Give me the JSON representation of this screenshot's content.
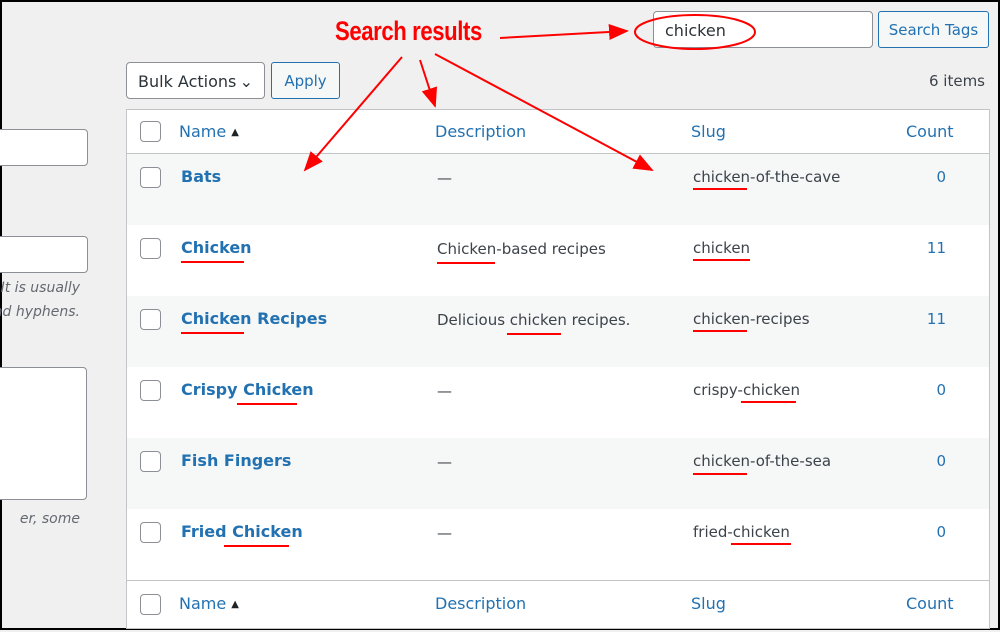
{
  "search": {
    "value": "chicken",
    "button": "Search Tags"
  },
  "bulk": {
    "select": "Bulk Actions",
    "apply": "Apply"
  },
  "items_count": "6 items",
  "left_form": {
    "hint1a": "It is usually",
    "hint1b": "nd hyphens.",
    "hint2": "er, some"
  },
  "columns": {
    "name": "Name",
    "description": "Description",
    "slug": "Slug",
    "count": "Count",
    "sort_icon": "triangle-up"
  },
  "rows": [
    {
      "name": "Bats",
      "description": "—",
      "slug": "chicken-of-the-cave",
      "count": "0"
    },
    {
      "name": "Chicken",
      "description": "Chicken-based recipes",
      "slug": "chicken",
      "count": "11"
    },
    {
      "name": "Chicken Recipes",
      "description": "Delicious chicken recipes.",
      "slug": "chicken-recipes",
      "count": "11"
    },
    {
      "name": "Crispy Chicken",
      "description": "—",
      "slug": "crispy-chicken",
      "count": "0"
    },
    {
      "name": "Fish Fingers",
      "description": "—",
      "slug": "chicken-of-the-sea",
      "count": "0"
    },
    {
      "name": "Fried Chicken",
      "description": "—",
      "slug": "fried-chicken",
      "count": "0"
    }
  ],
  "annotation": {
    "label": "Search results",
    "color": "#ff0000"
  }
}
